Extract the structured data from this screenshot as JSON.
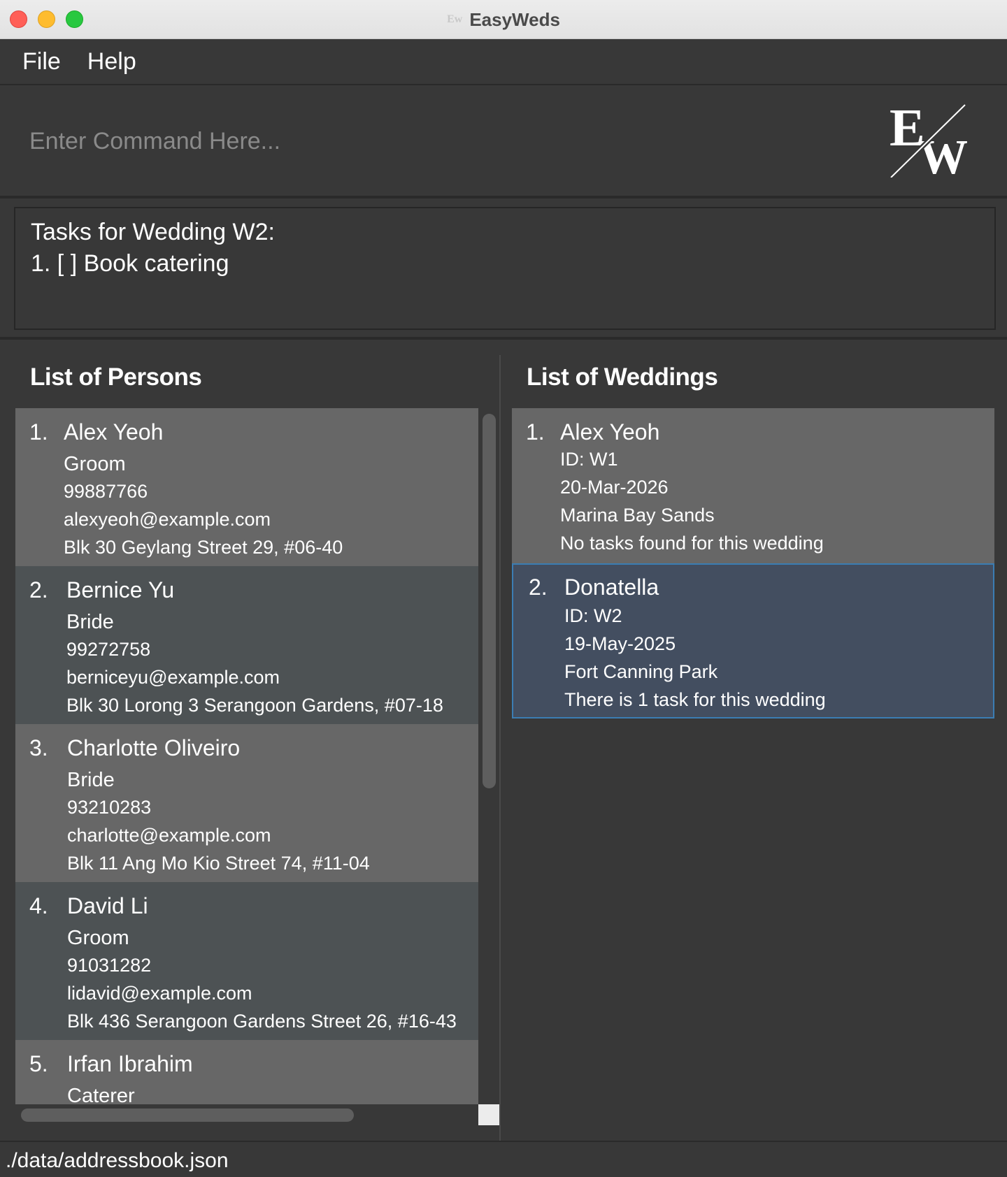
{
  "window": {
    "title": "EasyWeds",
    "icon_text": "Ew"
  },
  "menu": {
    "items": [
      "File",
      "Help"
    ]
  },
  "command": {
    "placeholder": "Enter Command Here...",
    "value": ""
  },
  "logo": {
    "text": "EW"
  },
  "result": {
    "lines": [
      "Tasks for Wedding W2:",
      "1. [ ] Book catering"
    ]
  },
  "persons": {
    "title": "List of Persons",
    "items": [
      {
        "index": "1.",
        "name": "Alex Yeoh",
        "role": "Groom",
        "phone": "99887766",
        "email": "alexyeoh@example.com",
        "address": "Blk 30 Geylang Street 29, #06-40"
      },
      {
        "index": "2.",
        "name": "Bernice Yu",
        "role": "Bride",
        "phone": "99272758",
        "email": "berniceyu@example.com",
        "address": "Blk 30 Lorong 3 Serangoon Gardens, #07-18"
      },
      {
        "index": "3.",
        "name": "Charlotte Oliveiro",
        "role": "Bride",
        "phone": "93210283",
        "email": "charlotte@example.com",
        "address": "Blk 11 Ang Mo Kio Street 74, #11-04"
      },
      {
        "index": "4.",
        "name": "David Li",
        "role": "Groom",
        "phone": "91031282",
        "email": "lidavid@example.com",
        "address": "Blk 436 Serangoon Gardens Street 26, #16-43"
      },
      {
        "index": "5.",
        "name": "Irfan Ibrahim",
        "role": "Caterer"
      }
    ]
  },
  "weddings": {
    "title": "List of Weddings",
    "items": [
      {
        "index": "1.",
        "name": "Alex Yeoh",
        "id": "ID: W1",
        "date": "20-Mar-2026",
        "venue": "Marina Bay Sands",
        "tasks": "No tasks found for this wedding"
      },
      {
        "index": "2.",
        "name": "Donatella",
        "id": "ID: W2",
        "date": "19-May-2025",
        "venue": "Fort Canning Park",
        "tasks": "There is 1 task for this wedding"
      }
    ]
  },
  "status": {
    "path": "./data/addressbook.json"
  },
  "colors": {
    "background": "#383838",
    "card_odd": "#676767",
    "card_even": "#4d5254",
    "selected": "#434e60",
    "selected_border": "#3b7db3"
  }
}
